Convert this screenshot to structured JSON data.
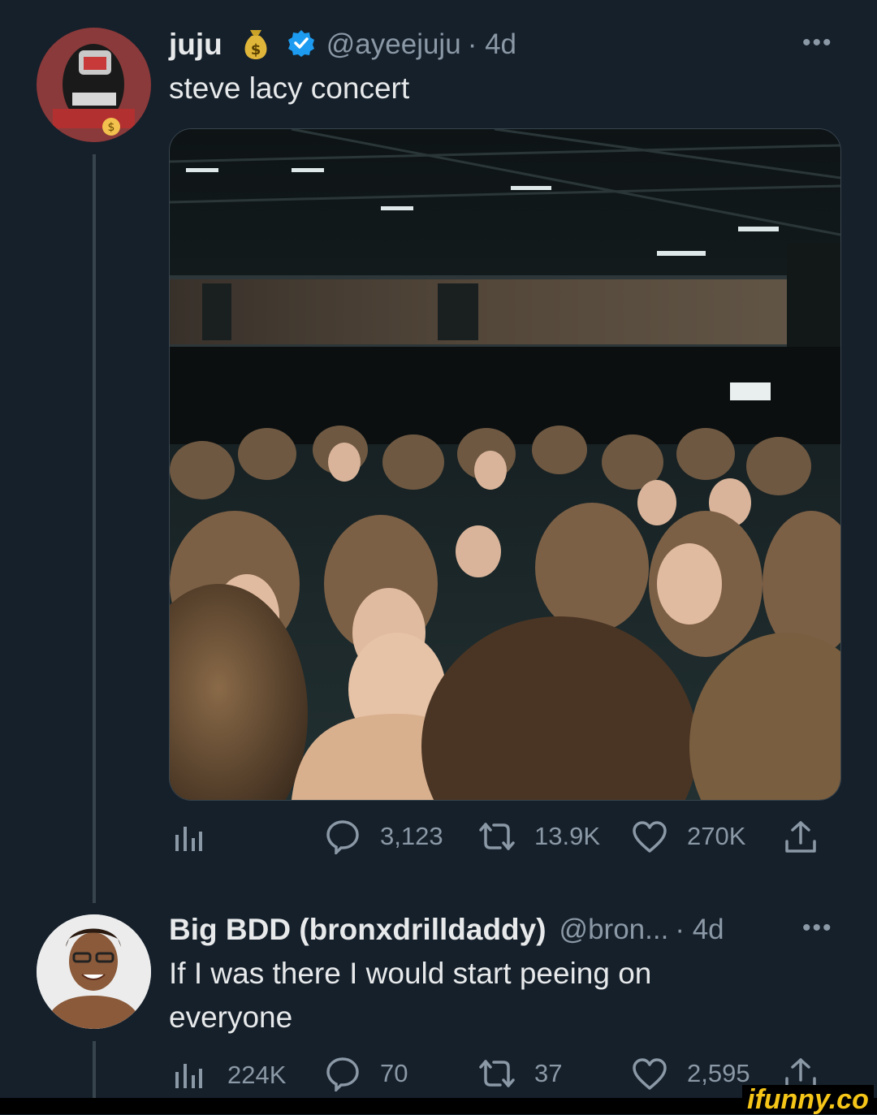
{
  "tweet": {
    "author_name": "juju",
    "author_emoji": "money-bag-icon",
    "verified": true,
    "handle": "@ayeejuju",
    "time": "· 4d",
    "text": "steve lacy concert",
    "more_label": "•••",
    "metrics": {
      "replies": "3,123",
      "retweets": "13.9K",
      "likes": "270K"
    },
    "colors": {
      "verified": "#1d9bf0"
    }
  },
  "reply": {
    "author_name": "Big BDD (bronxdrilldaddy)",
    "handle": "@bron...",
    "time": "· 4d",
    "text_line1": "If I was there I would start peeing on",
    "text_line2": "everyone",
    "more_label": "•••",
    "metrics": {
      "views": "224K",
      "replies": "70",
      "retweets": "37",
      "likes": "2,595"
    }
  },
  "watermark": {
    "brand": "ifunny.co"
  },
  "theme": {
    "background": "#15202b",
    "muted": "#8b98a5",
    "text": "#e7e9ea"
  }
}
